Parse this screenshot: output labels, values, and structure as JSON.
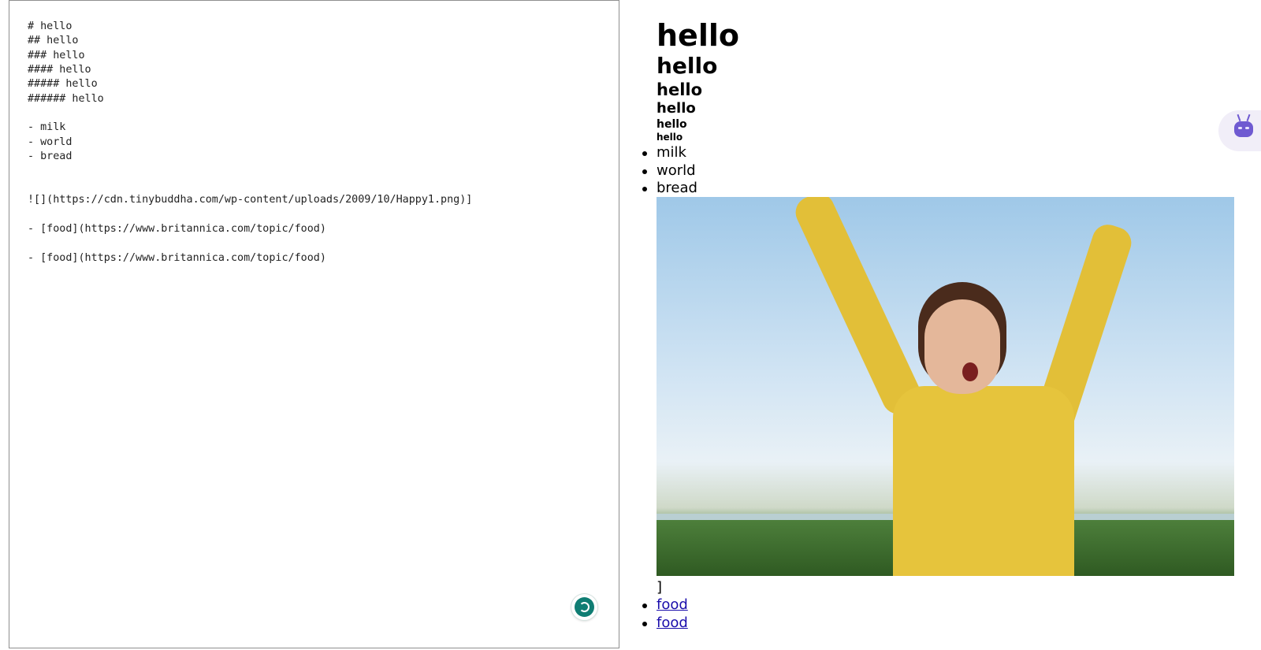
{
  "editor": {
    "source_lines": "# hello\n## hello\n### hello\n#### hello\n##### hello\n###### hello\n\n- milk\n- world\n- bread\n\n\n![](https://cdn.tinybuddha.com/wp-content/uploads/2009/10/Happy1.png)]\n\n- [food](https://www.britannica.com/topic/food)\n\n- [food](https://www.britannica.com/topic/food)"
  },
  "preview": {
    "headings": [
      "hello",
      "hello",
      "hello",
      "hello",
      "hello",
      "hello"
    ],
    "list_items": [
      "milk",
      "world",
      "bread"
    ],
    "trailing_text": "]",
    "links": [
      "food",
      "food"
    ]
  },
  "icons": {
    "grammar_badge": "grammar-check-icon",
    "assistant": "robot-assistant-icon"
  },
  "colors": {
    "link": "#1a0dab",
    "badge": "#0f7d73",
    "assistant": "#6f5ad1"
  }
}
